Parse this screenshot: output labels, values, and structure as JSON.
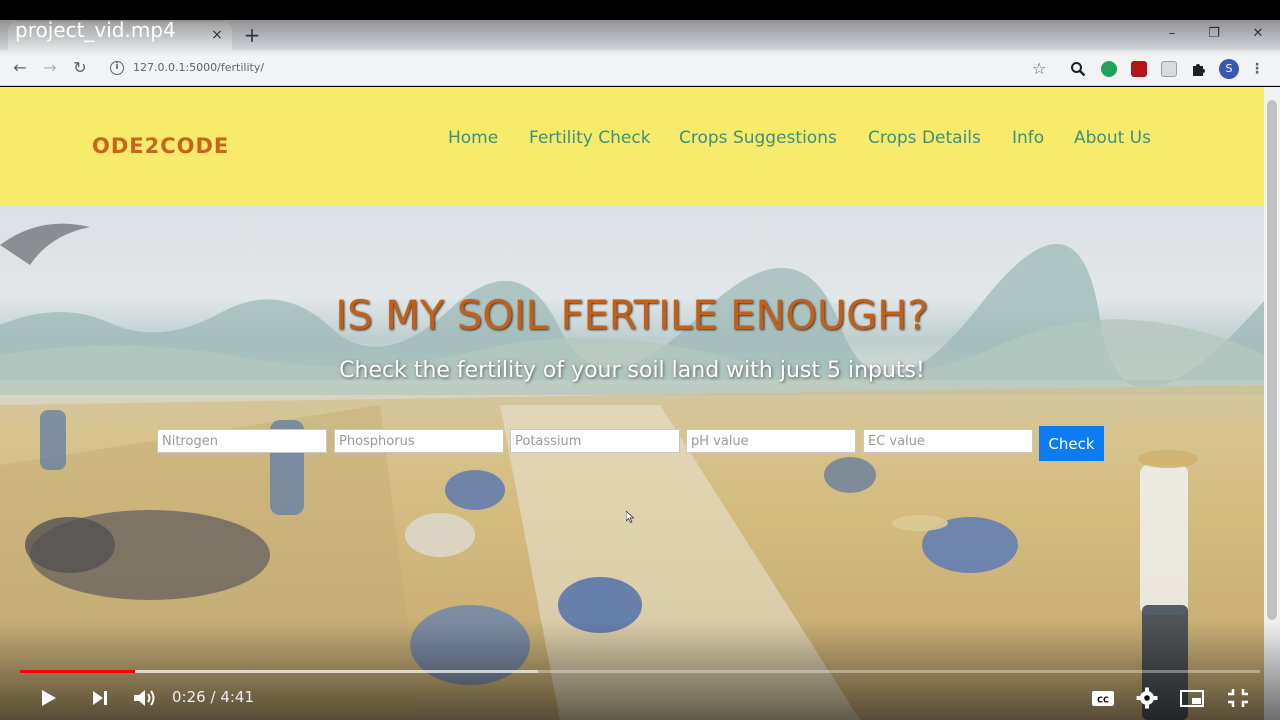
{
  "video": {
    "title": "project_vid.mp4",
    "current_time": "0:26",
    "separator": "/",
    "duration": "4:41",
    "progress_fraction": 0.093,
    "buffered_fraction": 0.418
  },
  "browser": {
    "tab_close_icon": "×",
    "new_tab_icon": "+",
    "url": "127.0.0.1:5000/fertility/",
    "avatar_letter": "S"
  },
  "site": {
    "brand": "ODE2CODE",
    "nav": [
      "Home",
      "Fertility Check",
      "Crops Suggestions",
      "Crops Details",
      "Info",
      "About Us"
    ],
    "hero_title": "IS MY SOIL FERTILE ENOUGH?",
    "hero_subtitle": "Check the fertility of your soil land with just 5 inputs!",
    "inputs": [
      {
        "placeholder": "Nitrogen",
        "value": ""
      },
      {
        "placeholder": "Phosphorus",
        "value": ""
      },
      {
        "placeholder": "Potassium",
        "value": ""
      },
      {
        "placeholder": "pH value",
        "value": ""
      },
      {
        "placeholder": "EC value",
        "value": ""
      }
    ],
    "check_label": "Check"
  },
  "colors": {
    "navbar_bg": "#f8ea6a",
    "brand": "#c8641e",
    "nav_link": "#3e8f7e",
    "hero_title": "#c0601a",
    "check_button": "#0d7cf2",
    "progress_played": "#ff0000"
  }
}
